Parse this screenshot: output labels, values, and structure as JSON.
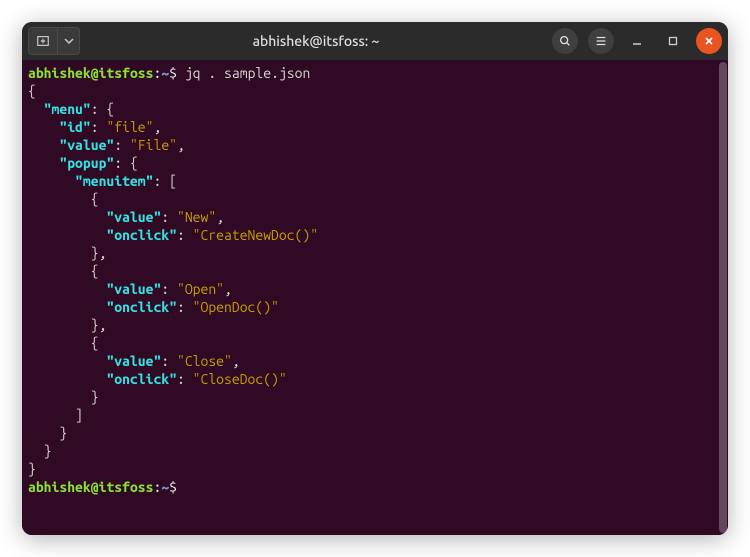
{
  "titlebar": {
    "title": "abhishek@itsfoss: ~"
  },
  "prompt": {
    "user": "abhishek",
    "host": "itsfoss",
    "path": "~",
    "symbol": "$"
  },
  "command": "jq . sample.json",
  "json_output": {
    "menu": {
      "id": "file",
      "value": "File",
      "popup": {
        "menuitem": [
          {
            "value": "New",
            "onclick": "CreateNewDoc()"
          },
          {
            "value": "Open",
            "onclick": "OpenDoc()"
          },
          {
            "value": "Close",
            "onclick": "CloseDoc()"
          }
        ]
      }
    }
  },
  "tokens": {
    "open_brace": "{",
    "close_brace": "}",
    "open_bracket": "[",
    "close_bracket": "]",
    "comma": ",",
    "colon_sp": ": ",
    "at": "@",
    "promptcolon": ":",
    "k_menu": "\"menu\"",
    "k_id": "\"id\"",
    "k_value": "\"value\"",
    "k_popup": "\"popup\"",
    "k_menuitem": "\"menuitem\"",
    "k_onclick": "\"onclick\"",
    "v_file": "\"file\"",
    "v_File": "\"File\"",
    "v_New": "\"New\"",
    "v_CreateNewDoc": "\"CreateNewDoc()\"",
    "v_Open": "\"Open\"",
    "v_OpenDoc": "\"OpenDoc()\"",
    "v_Close": "\"Close\"",
    "v_CloseDoc": "\"CloseDoc()\""
  }
}
